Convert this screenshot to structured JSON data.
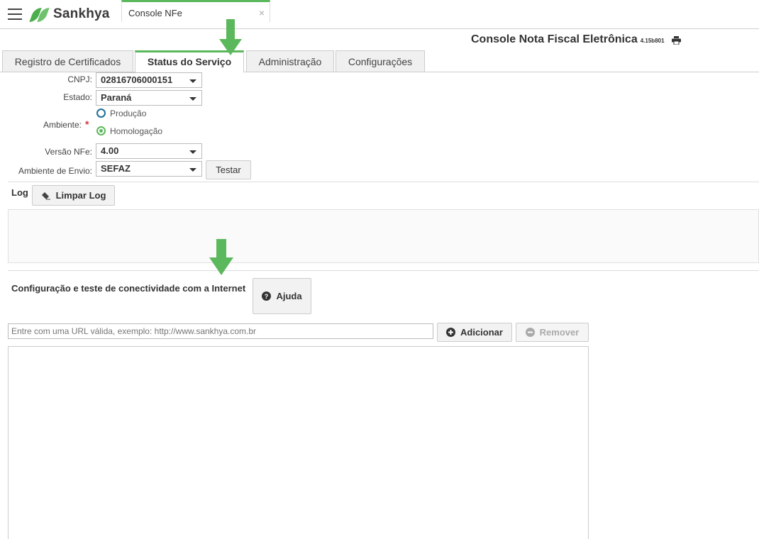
{
  "app": {
    "logo_text": "Sankhya",
    "open_tab_label": "Console NFe",
    "close_glyph": "×"
  },
  "header": {
    "title": "Console Nota Fiscal Eletrônica",
    "version": "4.15b801"
  },
  "tabs": [
    {
      "label": "Registro de Certificados",
      "active": false
    },
    {
      "label": "Status do Serviço",
      "active": true
    },
    {
      "label": "Administração",
      "active": false
    },
    {
      "label": "Configurações",
      "active": false
    }
  ],
  "form": {
    "cnpj_label": "CNPJ:",
    "cnpj_value": "02816706000151",
    "estado_label": "Estado:",
    "estado_value": "Paraná",
    "ambiente_label": "Ambiente:",
    "ambiente_required": "*",
    "ambiente_options": [
      {
        "label": "Produção",
        "selected": false
      },
      {
        "label": "Homologação",
        "selected": true
      }
    ],
    "versao_label": "Versão NFe:",
    "versao_value": "4.00",
    "envio_label": "Ambiente de Envio:",
    "envio_value": "SEFAZ",
    "testar_label": "Testar"
  },
  "log": {
    "label": "Log",
    "clear_label": "Limpar Log"
  },
  "connectivity": {
    "title": "Configuração e teste de conectividade com a Internet",
    "help_label": "Ajuda",
    "url_placeholder": "Entre com uma URL válida, exemplo: http://www.sankhya.com.br",
    "add_label": "Adicionar",
    "remove_label": "Remover"
  },
  "colors": {
    "accent_green": "#5cb85c",
    "radio_blue": "#1e6f9a",
    "required_red": "#d9363e"
  },
  "icons": [
    "menu-icon",
    "sankhya-logo-icon",
    "close-icon",
    "print-icon",
    "chevron-down-icon",
    "eraser-icon",
    "question-circle-icon",
    "plus-circle-icon",
    "minus-circle-icon",
    "arrow-down-icon"
  ]
}
